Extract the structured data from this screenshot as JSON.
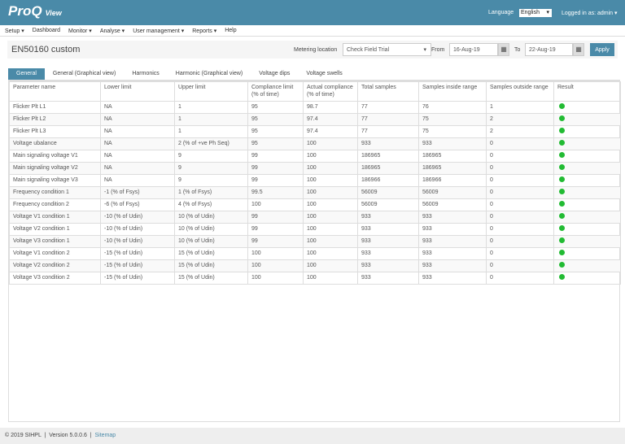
{
  "header": {
    "logo": "ProQ",
    "logo_sub": "View",
    "language_label": "Language",
    "language_value": "English",
    "logged_in": "Logged in as: admin ▾"
  },
  "nav": [
    "Setup ▾",
    "Dashboard",
    "Monitor ▾",
    "Analyse ▾",
    "User management ▾",
    "Reports ▾",
    "Help"
  ],
  "toolbar": {
    "title": "EN50160 custom",
    "metering_label": "Metering location",
    "metering_value": "Check Field Trial",
    "from_label": "From",
    "from_value": "16-Aug-19",
    "to_label": "To",
    "to_value": "22-Aug-19",
    "apply": "Apply"
  },
  "tabs": [
    "General",
    "General (Graphical view)",
    "Harmonics",
    "Harmonic (Graphical view)",
    "Voltage dips",
    "Voltage swells"
  ],
  "table": {
    "headers": [
      "Parameter name",
      "Lower limit",
      "Upper limit",
      "Compliance limit (% of time)",
      "Actual compliance (% of time)",
      "Total samples",
      "Samples inside range",
      "Samples outside range",
      "Result"
    ],
    "rows": [
      [
        "Flicker Plt L1",
        "NA",
        "1",
        "95",
        "98.7",
        "77",
        "76",
        "1"
      ],
      [
        "Flicker Plt L2",
        "NA",
        "1",
        "95",
        "97.4",
        "77",
        "75",
        "2"
      ],
      [
        "Flicker Plt L3",
        "NA",
        "1",
        "95",
        "97.4",
        "77",
        "75",
        "2"
      ],
      [
        "Voltage ubalance",
        "NA",
        "2 (% of +ve Ph Seq)",
        "95",
        "100",
        "933",
        "933",
        "0"
      ],
      [
        "Main signaling voltage V1",
        "NA",
        "9",
        "99",
        "100",
        "186965",
        "186965",
        "0"
      ],
      [
        "Main signaling voltage V2",
        "NA",
        "9",
        "99",
        "100",
        "186965",
        "186965",
        "0"
      ],
      [
        "Main signaling voltage V3",
        "NA",
        "9",
        "99",
        "100",
        "186966",
        "186966",
        "0"
      ],
      [
        "Frequency condition 1",
        "-1 (% of Fsys)",
        "1 (% of Fsys)",
        "99.5",
        "100",
        "56009",
        "56009",
        "0"
      ],
      [
        "Frequency condition 2",
        "-6 (% of Fsys)",
        "4 (% of Fsys)",
        "100",
        "100",
        "56009",
        "56009",
        "0"
      ],
      [
        "Voltage V1 condition 1",
        "-10 (% of Udin)",
        "10 (% of Udin)",
        "99",
        "100",
        "933",
        "933",
        "0"
      ],
      [
        "Voltage V2 condition 1",
        "-10 (% of Udin)",
        "10 (% of Udin)",
        "99",
        "100",
        "933",
        "933",
        "0"
      ],
      [
        "Voltage V3 condition 1",
        "-10 (% of Udin)",
        "10 (% of Udin)",
        "99",
        "100",
        "933",
        "933",
        "0"
      ],
      [
        "Voltage V1 condition 2",
        "-15 (% of Udin)",
        "15 (% of Udin)",
        "100",
        "100",
        "933",
        "933",
        "0"
      ],
      [
        "Voltage V2 condition 2",
        "-15 (% of Udin)",
        "15 (% of Udin)",
        "100",
        "100",
        "933",
        "933",
        "0"
      ],
      [
        "Voltage V3 condition 2",
        "-15 (% of Udin)",
        "15 (% of Udin)",
        "100",
        "100",
        "933",
        "933",
        "0"
      ]
    ],
    "result_status": "pass",
    "result_color": "#22bb33"
  },
  "footer": {
    "copyright": "© 2019 SIHPL",
    "version": "Version 5.0.0.6",
    "sitemap": "Sitemap"
  }
}
